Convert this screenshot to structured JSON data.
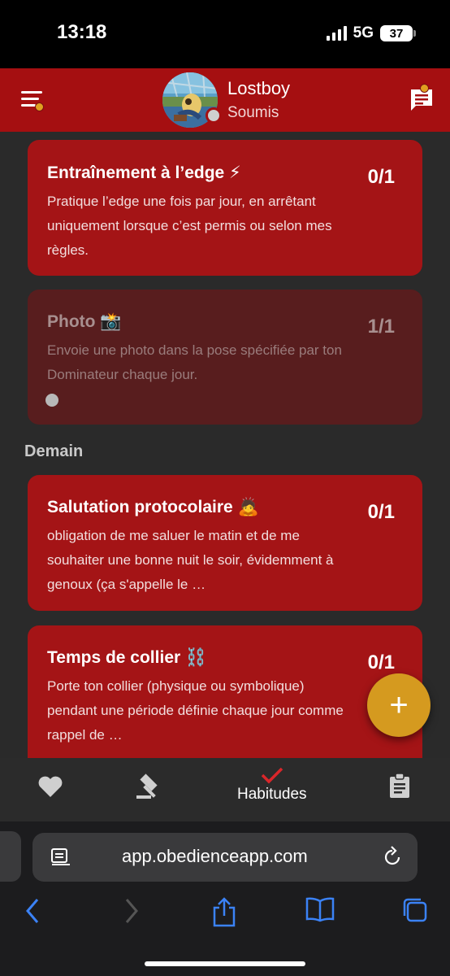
{
  "status_bar": {
    "time": "13:18",
    "network": "5G",
    "battery": "37"
  },
  "header": {
    "user_name": "Lostboy",
    "user_status": "Soumis"
  },
  "tasks_today": [
    {
      "title": "Entraînement à l’edge ⚡",
      "description": "Pratique l’edge une fois par jour, en arrêtant uniquement lorsque c’est permis ou selon mes règles.",
      "count": "0/1"
    },
    {
      "title": "Photo 📸",
      "description": "Envoie une photo dans la pose spécifiée par ton Dominateur chaque jour.",
      "count": "1/1"
    }
  ],
  "section_tomorrow": "Demain",
  "tasks_tomorrow": [
    {
      "title": "Salutation protocolaire 🙇",
      "description": "obligation de me saluer le matin et de me souhaiter une bonne nuit le soir, évidemment à genoux (ça s'appelle le …",
      "count": "0/1"
    },
    {
      "title": "Temps de collier ⛓️",
      "description": "Porte ton collier (physique ou symbolique) pendant une période définie chaque jour comme rappel de …",
      "count": "0/1"
    }
  ],
  "fab_label": "+",
  "bottom_nav": {
    "active_label": "Habitudes"
  },
  "browser": {
    "url": "app.obedienceapp.com"
  },
  "icons": [
    "menu-icon",
    "chat-icon",
    "heart-icon",
    "gavel-icon",
    "check-icon",
    "clipboard-icon",
    "reader-icon",
    "reload-icon",
    "back-icon",
    "forward-icon",
    "share-icon",
    "book-icon",
    "tabs-icon"
  ]
}
